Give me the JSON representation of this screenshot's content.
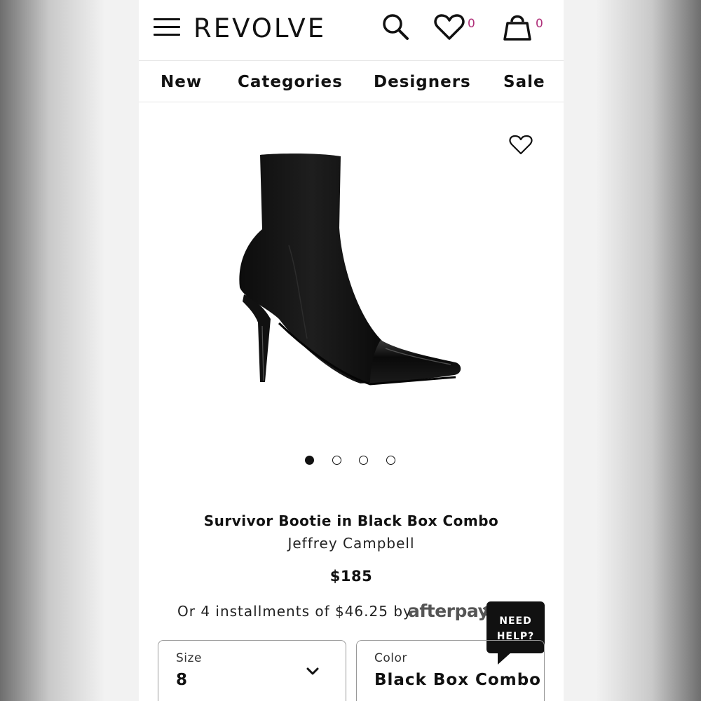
{
  "header": {
    "logo": "REVOLVE",
    "wishlist_count": "0",
    "bag_count": "0"
  },
  "nav": {
    "items": [
      "New",
      "Categories",
      "Designers",
      "Sale"
    ]
  },
  "carousel": {
    "total": 4,
    "active_index": 0
  },
  "product": {
    "title": "Survivor Bootie in Black Box Combo",
    "brand": "Jeffrey Campbell",
    "price": "$185",
    "installments_text": "Or 4 installments of $46.25 by",
    "afterpay_label": "afterpay"
  },
  "help": {
    "line1": "NEED",
    "line2": "HELP?",
    "question_mark": "?"
  },
  "size_select": {
    "label": "Size",
    "value": "8"
  },
  "color_select": {
    "label": "Color",
    "value": "Black Box Combo"
  },
  "colors": {
    "accent_count": "#b0307a",
    "text": "#111111"
  }
}
